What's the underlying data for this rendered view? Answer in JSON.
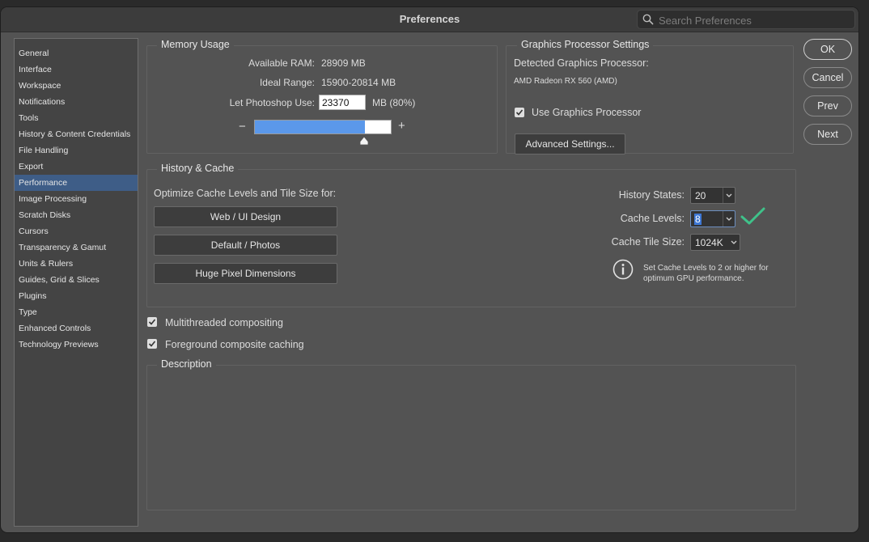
{
  "window": {
    "title": "Preferences"
  },
  "search": {
    "placeholder": "Search Preferences"
  },
  "sidebar": {
    "active_index": 8,
    "items": [
      "General",
      "Interface",
      "Workspace",
      "Notifications",
      "Tools",
      "History & Content Credentials",
      "File Handling",
      "Export",
      "Performance",
      "Image Processing",
      "Scratch Disks",
      "Cursors",
      "Transparency & Gamut",
      "Units & Rulers",
      "Guides, Grid & Slices",
      "Plugins",
      "Type",
      "Enhanced Controls",
      "Technology Previews"
    ]
  },
  "memory": {
    "title": "Memory Usage",
    "available_label": "Available RAM:",
    "available_value": "28909 MB",
    "ideal_label": "Ideal Range:",
    "ideal_value": "15900-20814 MB",
    "use_label": "Let Photoshop Use:",
    "use_value": "23370",
    "use_suffix": "MB (80%)",
    "slider_fraction": 0.8,
    "minus": "−",
    "plus": "+"
  },
  "gpu": {
    "title": "Graphics Processor Settings",
    "detected_label": "Detected Graphics Processor:",
    "detected_value": "AMD Radeon RX 560 (AMD)",
    "use_gpu_label": "Use Graphics Processor",
    "use_gpu_checked": true,
    "advanced_button": "Advanced Settings..."
  },
  "cache": {
    "title": "History & Cache",
    "optimize_label": "Optimize Cache Levels and Tile Size for:",
    "buttons": [
      "Web / UI Design",
      "Default / Photos",
      "Huge Pixel Dimensions"
    ],
    "history_label": "History States:",
    "history_value": "20",
    "levels_label": "Cache Levels:",
    "levels_value": "8",
    "tile_label": "Cache Tile Size:",
    "tile_value": "1024K",
    "info_text_1": "Set Cache Levels to 2 or higher for",
    "info_text_2": "optimum GPU performance."
  },
  "options": {
    "multithreaded_label": "Multithreaded compositing",
    "foreground_label": "Foreground composite caching"
  },
  "description": {
    "title": "Description"
  },
  "actions": {
    "ok": "OK",
    "cancel": "Cancel",
    "prev": "Prev",
    "next": "Next"
  },
  "colors": {
    "accent": "#3e5d87",
    "slider_fill": "#5b98ea",
    "check_green": "#3fc28a"
  }
}
